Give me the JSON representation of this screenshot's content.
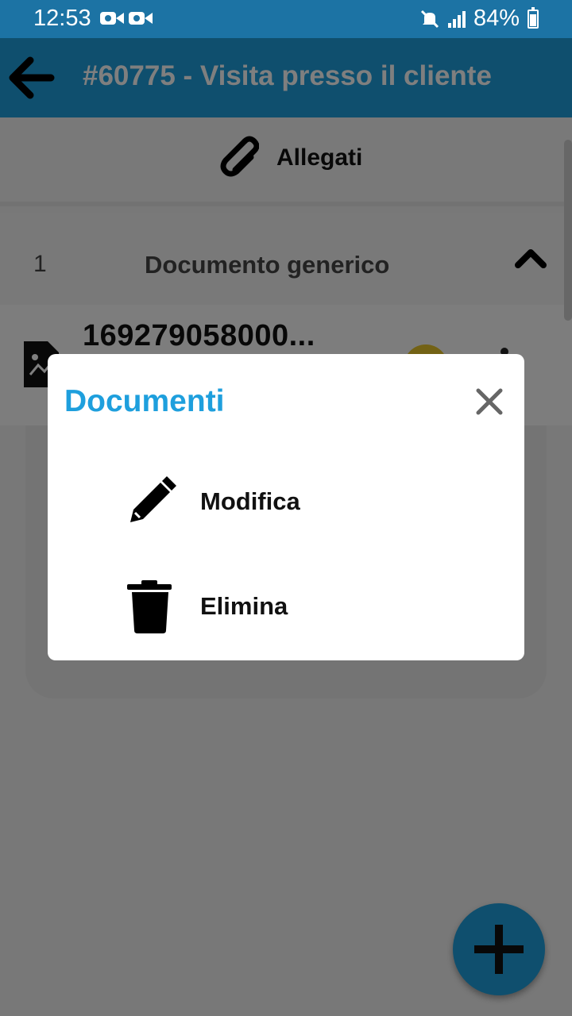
{
  "status_bar": {
    "time": "12:53",
    "battery_percent": "84%",
    "icons": [
      "video-camera-icon",
      "video-camera-icon",
      "mute-icon",
      "signal-icon",
      "battery-icon"
    ]
  },
  "header": {
    "title": "#60775 - Visita presso il cliente",
    "back_icon": "arrow-left-icon"
  },
  "attachments": {
    "label": "Allegati",
    "icon": "paperclip-icon"
  },
  "group": {
    "count": "1",
    "title": "Documento generico",
    "toggle_icon": "chevron-up-icon"
  },
  "document": {
    "name": "169279058000...",
    "icon": "image-file-icon"
  },
  "dialog": {
    "title": "Documenti",
    "close_icon": "close-icon",
    "actions": [
      {
        "label": "Modifica",
        "icon": "pencil-icon"
      },
      {
        "label": "Elimina",
        "icon": "trash-icon"
      }
    ]
  },
  "fab": {
    "icon": "plus-icon"
  },
  "colors": {
    "accent": "#1e9fdd",
    "status_bar": "#1c73a4",
    "avatar": "#e6c52a"
  }
}
